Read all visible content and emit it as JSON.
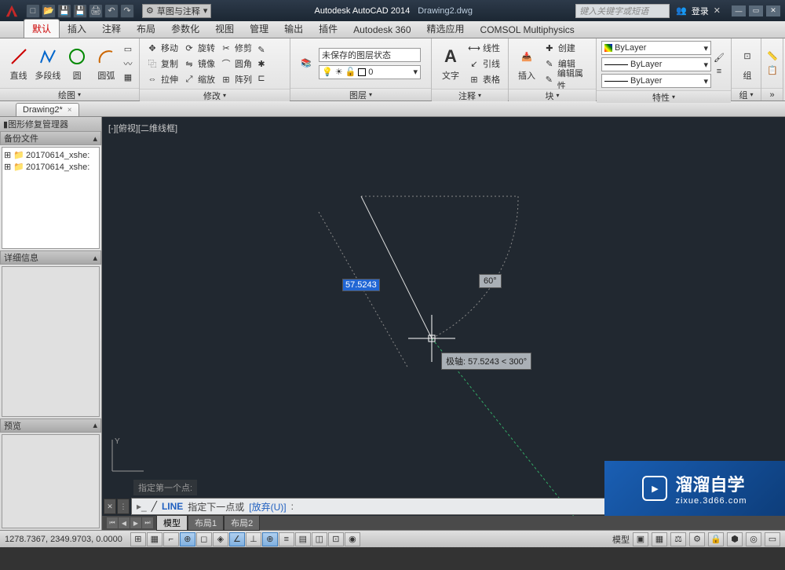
{
  "titlebar": {
    "app_title": "Autodesk AutoCAD 2014",
    "doc_title": "Drawing2.dwg",
    "search_placeholder": "键入关键字或短语",
    "login_label": "登录",
    "workspace": "草图与注释"
  },
  "ribbon_tabs": [
    "默认",
    "插入",
    "注释",
    "布局",
    "参数化",
    "视图",
    "管理",
    "输出",
    "插件",
    "Autodesk 360",
    "精选应用",
    "COMSOL Multiphysics"
  ],
  "panels": {
    "draw": {
      "title": "绘图",
      "line": "直线",
      "polyline": "多段线",
      "circle": "圆",
      "arc": "圆弧"
    },
    "modify": {
      "title": "修改",
      "move": "移动",
      "copy": "复制",
      "stretch": "拉伸",
      "rotate": "旋转",
      "mirror": "镜像",
      "scale": "缩放",
      "trim": "修剪",
      "fillet": "圆角",
      "array": "阵列"
    },
    "layers": {
      "title": "图层",
      "unsaved_state": "未保存的图层状态",
      "layer0": "0"
    },
    "annotation": {
      "title": "注释",
      "text": "文字",
      "linear": "线性",
      "leader": "引线",
      "table": "表格"
    },
    "block": {
      "title": "块",
      "insert": "插入",
      "create": "创建",
      "edit": "编辑",
      "edit_attr": "编辑属性"
    },
    "properties": {
      "title": "特性",
      "bylayer": "ByLayer"
    },
    "group": {
      "title": "组",
      "group": "组"
    }
  },
  "filetab": "Drawing2*",
  "palette": {
    "title": "图形修复管理器",
    "backup_header": "备份文件",
    "files": [
      "20170614_xshe:",
      "20170614_xshe:"
    ],
    "details_header": "详细信息",
    "preview_header": "预览"
  },
  "viewport": {
    "label": "[-][俯视][二维线框]",
    "distance_input": "57.5243",
    "angle_label": "60°",
    "polar_tooltip": "极轴: 57.5243 < 300°",
    "history_line": "指定第一个点:",
    "cmd_name": "LINE",
    "cmd_prompt": "指定下一点或",
    "cmd_option": "[放弃(U)]",
    "cmd_cursor": ":"
  },
  "model_tabs": [
    "模型",
    "布局1",
    "布局2"
  ],
  "statusbar": {
    "coords": "1278.7367, 2349.9703, 0.0000",
    "model_label": "模型"
  },
  "watermark": {
    "main": "溜溜自学",
    "sub": "zixue.3d66.com"
  }
}
